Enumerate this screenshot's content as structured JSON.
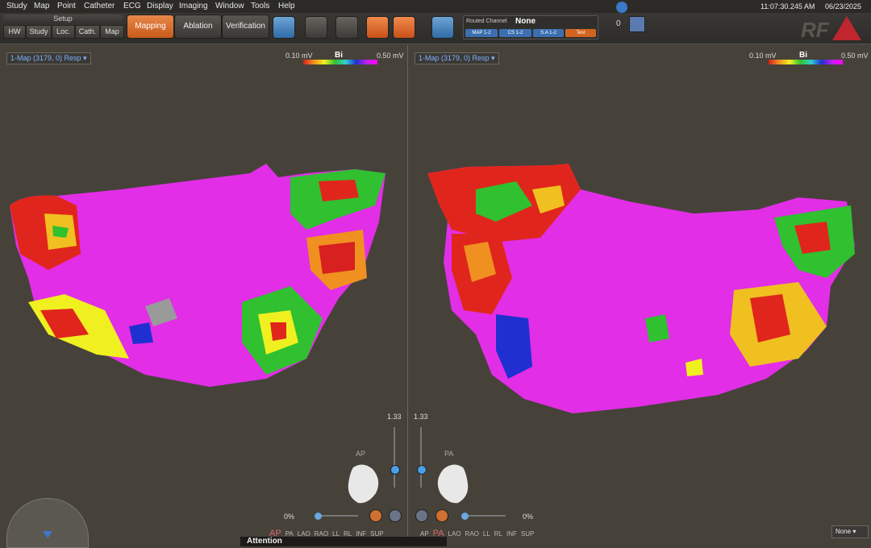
{
  "menu": [
    "Study",
    "Map",
    "Point",
    "Catheter",
    "ECG",
    "Display",
    "Imaging",
    "Window",
    "Tools",
    "Help"
  ],
  "toolbar": {
    "setup_label": "Setup",
    "setup_tabs": [
      "HW",
      "Study",
      "Loc.",
      "Cath.",
      "Map"
    ],
    "modes": [
      {
        "label": "Mapping",
        "active": true
      },
      {
        "label": "Ablation",
        "active": false
      },
      {
        "label": "Verification",
        "active": false
      }
    ],
    "routed_channel": {
      "label": "Routed Channel",
      "value": "None",
      "channels": [
        "MAP 1-2",
        "CS 1-2",
        "S.A 1-2",
        "Test"
      ]
    },
    "small_value": "0"
  },
  "clock": {
    "time": "11:07:30.245 AM",
    "date": "06/23/2025"
  },
  "logo": "RF",
  "left_view": {
    "map_select": "1-Map (3179, 0) Resp",
    "cb_min": "0.10 mV",
    "cb_title": "Bi",
    "cb_max": "0.50 mV",
    "zoom": "1.33",
    "view_label": "AP",
    "pct": "0%",
    "views": [
      "AP",
      "PA",
      "LAO",
      "RAO",
      "LL",
      "RL",
      "INF",
      "SUP"
    ]
  },
  "right_view": {
    "map_select": "1-Map (3179, 0) Resp",
    "cb_min": "0.10 mV",
    "cb_title": "Bi",
    "cb_max": "0.50 mV",
    "zoom": "1.33",
    "view_label": "PA",
    "pct": "0%",
    "views": [
      "AP",
      "PA",
      "LAO",
      "RAO",
      "LL",
      "RL",
      "INF",
      "SUP"
    ]
  },
  "attention": "Attention",
  "bottom_select": "None",
  "colors": {
    "magenta": "#e22ee6",
    "accent_orange": "#d2641f",
    "accent_blue": "#3d6fb0"
  }
}
